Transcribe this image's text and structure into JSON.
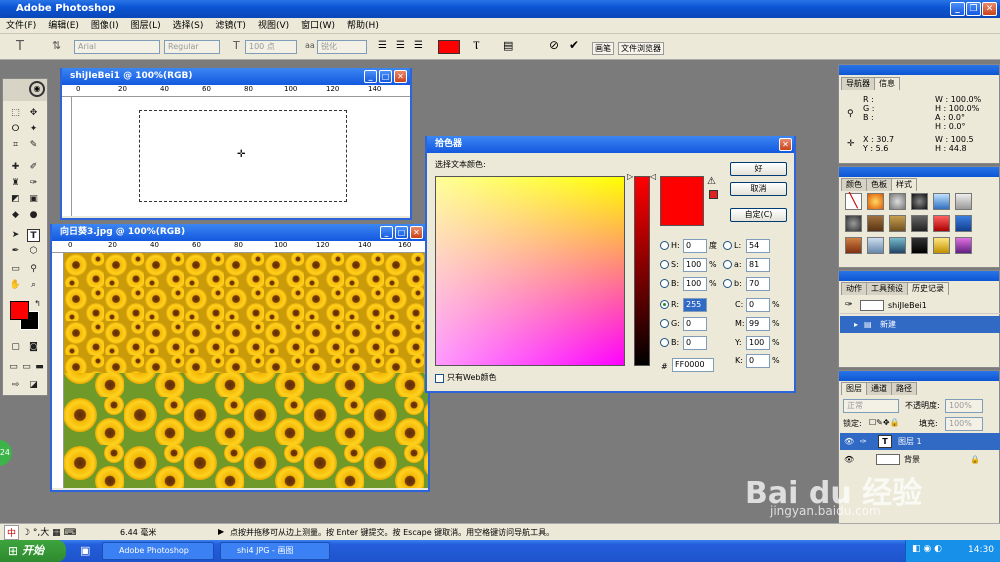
{
  "app": {
    "title": "Adobe Photoshop"
  },
  "menu": [
    "文件(F)",
    "编辑(E)",
    "图像(I)",
    "图层(L)",
    "选择(S)",
    "滤镜(T)",
    "视图(V)",
    "窗口(W)",
    "帮助(H)"
  ],
  "options": {
    "font_family": "Arial",
    "font_style": "Regular",
    "font_size": "100 点",
    "anti_alias": "锐化",
    "color": "#FF0000",
    "tab_brush": "画笔",
    "tab_browser": "文件浏览器"
  },
  "doc1": {
    "title": "shiJIeBei1 @ 100%(RGB)",
    "ruler_marks": [
      "0",
      "20",
      "40",
      "60",
      "80",
      "100",
      "120",
      "140"
    ]
  },
  "doc2": {
    "title": "向日葵3.jpg @ 100%(RGB)",
    "ruler_marks": [
      "0",
      "20",
      "40",
      "60",
      "80",
      "100",
      "120",
      "140",
      "160"
    ]
  },
  "picker": {
    "title": "拾色器",
    "subtitle": "选择文本颜色:",
    "ok": "好",
    "cancel": "取消",
    "custom": "自定(C)",
    "web_only": "只有Web颜色",
    "hsb": [
      {
        "k": "H:",
        "v": "0",
        "u": "度"
      },
      {
        "k": "S:",
        "v": "100",
        "u": "%"
      },
      {
        "k": "B:",
        "v": "100",
        "u": "%"
      }
    ],
    "rgb": [
      {
        "k": "R:",
        "v": "255"
      },
      {
        "k": "G:",
        "v": "0"
      },
      {
        "k": "B:",
        "v": "0"
      }
    ],
    "lab": [
      {
        "k": "L:",
        "v": "54"
      },
      {
        "k": "a:",
        "v": "81"
      },
      {
        "k": "b:",
        "v": "70"
      }
    ],
    "cmyk": [
      {
        "k": "C:",
        "v": "0",
        "u": "%"
      },
      {
        "k": "M:",
        "v": "99",
        "u": "%"
      },
      {
        "k": "Y:",
        "v": "100",
        "u": "%"
      },
      {
        "k": "K:",
        "v": "0",
        "u": "%"
      }
    ],
    "hex_prefix": "#",
    "hex": "FF0000",
    "current_color": "#FF0000"
  },
  "navigator": {
    "tab1": "导航器",
    "tab2": "信息",
    "r": "R :",
    "g": "G :",
    "b": "B :",
    "w1": "W : 100.0%",
    "h1": "H : 100.0%",
    "a": "A :  0.0°",
    "h2": "H :  0.0°",
    "x": "X :  30.7",
    "y": "Y :  5.6",
    "w2": "W :  100.5",
    "h3": "H :  44.8"
  },
  "swatches": {
    "tab1": "颜色",
    "tab2": "色板",
    "tab3": "样式"
  },
  "history": {
    "tab1": "动作",
    "tab2": "工具预设",
    "tab3": "历史记录",
    "snapshot": "shiJIeBei1",
    "state": "新建"
  },
  "layers": {
    "tab1": "图层",
    "tab2": "通道",
    "tab3": "路径",
    "blend": "正常",
    "opacity_label": "不透明度:",
    "opacity": "100%",
    "lock_label": "锁定:",
    "fill_label": "填充:",
    "fill": "100%",
    "layer1": "图层 1",
    "layer2": "背景"
  },
  "status": {
    "ime": "中",
    "units": "6.44 毫米",
    "hint": "点按并拖移可从边上测量。按 Enter 键提交。按 Escape 键取消。用空格键访问导航工具。"
  },
  "taskbar": {
    "start": "开始",
    "task1": "Adobe Photoshop",
    "task2": "shi4 JPG - 画图",
    "clock": "14:30"
  },
  "watermark": {
    "brand": "Bai du 经验",
    "url": "jingyan.baidu.com"
  }
}
